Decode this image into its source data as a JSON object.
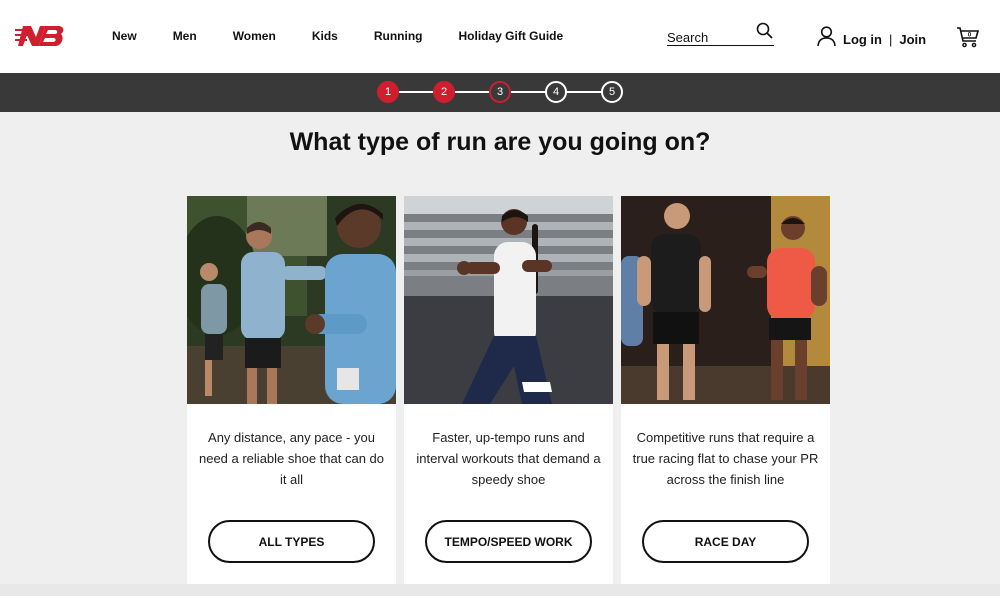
{
  "header": {
    "nav": [
      "New",
      "Men",
      "Women",
      "Kids",
      "Running",
      "Holiday Gift Guide"
    ],
    "search_placeholder": "Search",
    "login_label": "Log in",
    "join_label": "Join",
    "cart_count": "0"
  },
  "progress": {
    "steps": [
      "1",
      "2",
      "3",
      "4",
      "5"
    ],
    "current_step": 3
  },
  "page": {
    "title": "What type of run are you going on?"
  },
  "cards": [
    {
      "description": "Any distance, any pace - you need a reliable shoe that can do it all",
      "button": "ALL TYPES"
    },
    {
      "description": "Faster, up-tempo runs and interval workouts that demand a speedy shoe",
      "button": "TEMPO/SPEED WORK"
    },
    {
      "description": "Competitive runs that require a true racing flat to chase your PR across the finish line",
      "button": "RACE DAY"
    }
  ],
  "colors": {
    "brand_red": "#cf1f2e",
    "step_bar": "#393939",
    "page_bg": "#efefef"
  }
}
